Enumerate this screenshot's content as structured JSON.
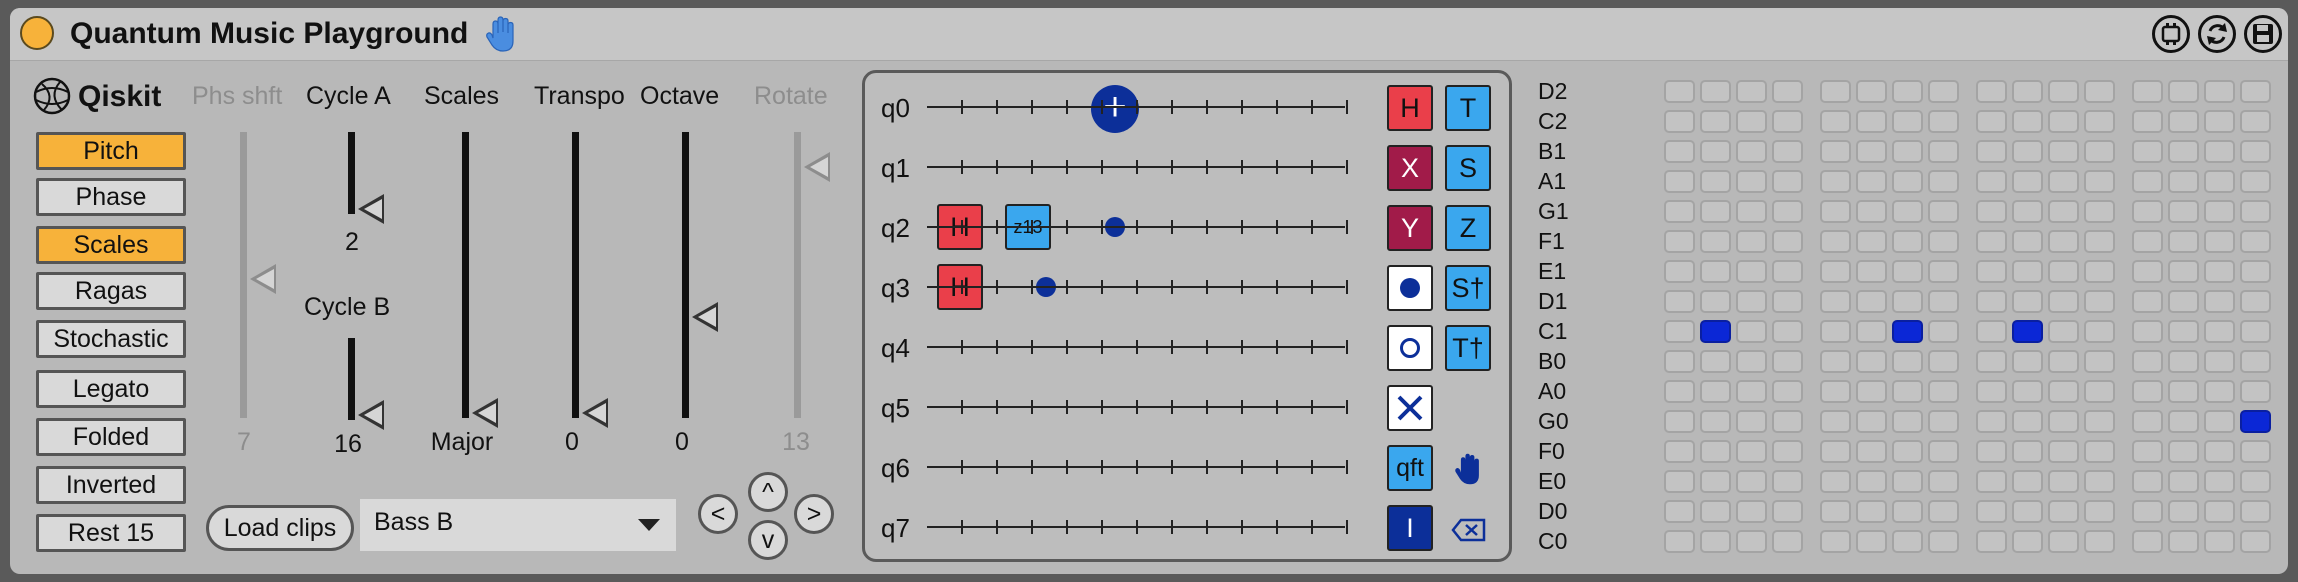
{
  "title": "Quantum Music Playground",
  "logo_text": "Qiskit",
  "icons": {
    "power": "power-icon",
    "hand": "hand-icon",
    "header_buttons": [
      "midi-map-icon",
      "reset-icon",
      "save-icon"
    ]
  },
  "modes": [
    {
      "label": "Pitch",
      "active": true
    },
    {
      "label": "Phase",
      "active": false
    },
    {
      "label": "Scales",
      "active": true
    },
    {
      "label": "Ragas",
      "active": false
    },
    {
      "label": "Stochastic",
      "active": false
    },
    {
      "label": "Legato",
      "active": false
    },
    {
      "label": "Folded",
      "active": false
    },
    {
      "label": "Inverted",
      "active": false
    },
    {
      "label": "Rest 15",
      "active": false
    }
  ],
  "dials": {
    "phase_shift": {
      "label": "Phs shft",
      "value": "7",
      "enabled": false
    },
    "cycle_a": {
      "label": "Cycle A",
      "value": "2"
    },
    "cycle_b": {
      "label": "Cycle B",
      "value": "16"
    },
    "scales": {
      "label": "Scales",
      "value": "Major"
    },
    "transpose": {
      "label": "Transpo",
      "value": "0"
    },
    "octave": {
      "label": "Octave",
      "value": "0"
    },
    "rotate": {
      "label": "Rotate",
      "value": "13",
      "enabled": false
    }
  },
  "load_clips_label": "Load clips",
  "clip_select": {
    "value": "Bass B"
  },
  "nav": {
    "up": "^",
    "left": "<",
    "right": ">",
    "down": "v"
  },
  "circuit": {
    "qubits": [
      "q0",
      "q1",
      "q2",
      "q3",
      "q4",
      "q5",
      "q6",
      "q7"
    ],
    "placed_gates": [
      {
        "qubit": "q0",
        "type": "cnot-target",
        "label": "+"
      },
      {
        "qubit": "q2",
        "type": "H",
        "label": "H"
      },
      {
        "qubit": "q2",
        "type": "Rz",
        "label": "z13"
      },
      {
        "qubit": "q2",
        "type": "control",
        "label": ""
      },
      {
        "qubit": "q3",
        "type": "H",
        "label": "H"
      },
      {
        "qubit": "q3",
        "type": "control",
        "label": ""
      }
    ],
    "palette_left": [
      "H",
      "X",
      "Y",
      "●",
      "○",
      "✕",
      "qft",
      "I"
    ],
    "palette_right": [
      "T",
      "S",
      "Z",
      "S†",
      "T†"
    ]
  },
  "notes": [
    "D2",
    "C2",
    "B1",
    "A1",
    "G1",
    "F1",
    "E1",
    "D1",
    "C1",
    "B0",
    "A0",
    "G0",
    "F0",
    "E0",
    "D0",
    "C0"
  ],
  "step_grid": {
    "steps": 16,
    "active": [
      {
        "note": "C1",
        "step": 1
      },
      {
        "note": "C1",
        "step": 6
      },
      {
        "note": "C1",
        "step": 9
      },
      {
        "note": "G0",
        "step": 15
      }
    ]
  },
  "colors": {
    "pitch_active": "#f7b23a",
    "gate_h": "#ea3f4a",
    "gate_phase": "#3aa7ee",
    "gate_xy": "#a11b49",
    "control": "#0c2f99",
    "grid_active": "#0b27d6"
  }
}
